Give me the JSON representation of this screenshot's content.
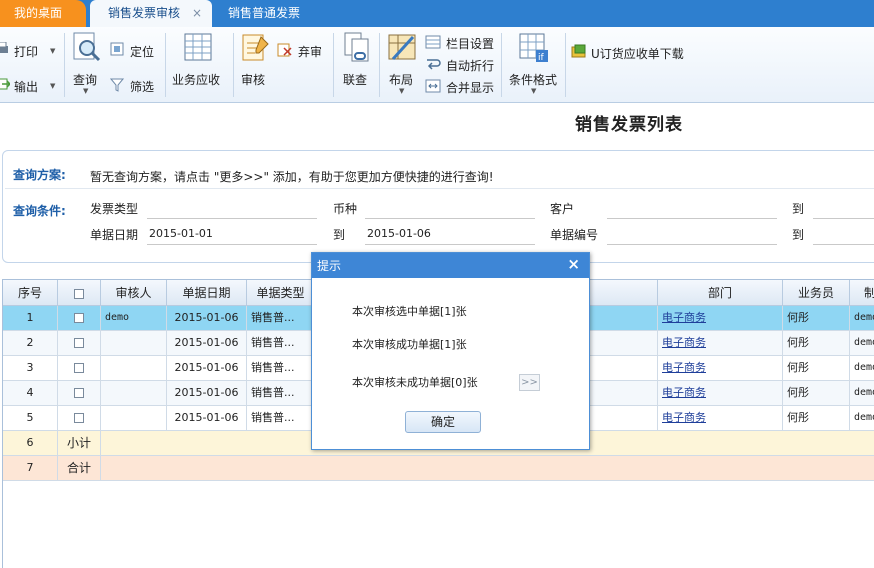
{
  "tabs": {
    "home": "我的桌面",
    "active": "销售发票审核",
    "close_glyph": "×",
    "other": "销售普通发票"
  },
  "toolbar": {
    "print": "打印",
    "export": "输出",
    "query": "查询",
    "locate": "定位",
    "filter": "筛选",
    "business_receivable": "业务应收",
    "audit": "审核",
    "abandon": "弃审",
    "link_query": "联查",
    "layout": "布局",
    "column_settings": "栏目设置",
    "auto_wrap": "自动折行",
    "merge_display": "合并显示",
    "condition_format": "条件格式",
    "order_download": "U订货应收单下载"
  },
  "page": {
    "title": "销售发票列表"
  },
  "query": {
    "scheme_label": "查询方案:",
    "scheme_hint": "暂无查询方案，请点击 \"更多>>\" 添加，有助于您更加方便快捷的进行查询!",
    "conditions_label": "查询条件:",
    "invoice_type_label": "发票类型",
    "currency_label": "币种",
    "customer_label": "客户",
    "to_label": "到",
    "doc_date_label": "单据日期",
    "doc_date_from": "2015-01-01",
    "doc_date_to": "2015-01-06",
    "doc_no_label": "单据编号"
  },
  "grid": {
    "headers": {
      "seq": "序号",
      "reviewer": "审核人",
      "doc_date": "单据日期",
      "doc_type": "单据类型",
      "dept": "部门",
      "salesman": "业务员",
      "maker": "制"
    },
    "rows": [
      {
        "seq": "1",
        "reviewer": "demo",
        "date": "2015-01-06",
        "type": "销售普...",
        "dept": "电子商务",
        "salesman": "何彤",
        "maker": "demo"
      },
      {
        "seq": "2",
        "reviewer": "",
        "date": "2015-01-06",
        "type": "销售普...",
        "dept": "电子商务",
        "salesman": "何彤",
        "maker": "demo"
      },
      {
        "seq": "3",
        "reviewer": "",
        "date": "2015-01-06",
        "type": "销售普...",
        "dept": "电子商务",
        "salesman": "何彤",
        "maker": "demo"
      },
      {
        "seq": "4",
        "reviewer": "",
        "date": "2015-01-06",
        "type": "销售普...",
        "dept": "电子商务",
        "salesman": "何彤",
        "maker": "demo"
      },
      {
        "seq": "5",
        "reviewer": "",
        "date": "2015-01-06",
        "type": "销售普...",
        "dept": "电子商务",
        "salesman": "何彤",
        "maker": "demo"
      }
    ],
    "subtotal_seq": "6",
    "subtotal_label": "小计",
    "total_seq": "7",
    "total_label": "合计"
  },
  "dialog": {
    "title": "提示",
    "close": "×",
    "msg_selected": "本次审核选中单据[1]张",
    "msg_success": "本次审核成功单据[1]张",
    "msg_failed": "本次审核未成功单据[0]张",
    "more": ">>",
    "ok": "确定"
  },
  "colors": {
    "tab_home": "#f7911e",
    "tab_bar": "#2e7fcf",
    "dialog_header": "#3e86d6",
    "selected_row": "#8fd6f3",
    "subtotal_row": "#fdf5d9",
    "total_row": "#fde6d6",
    "query_label": "#1f5fa8"
  }
}
